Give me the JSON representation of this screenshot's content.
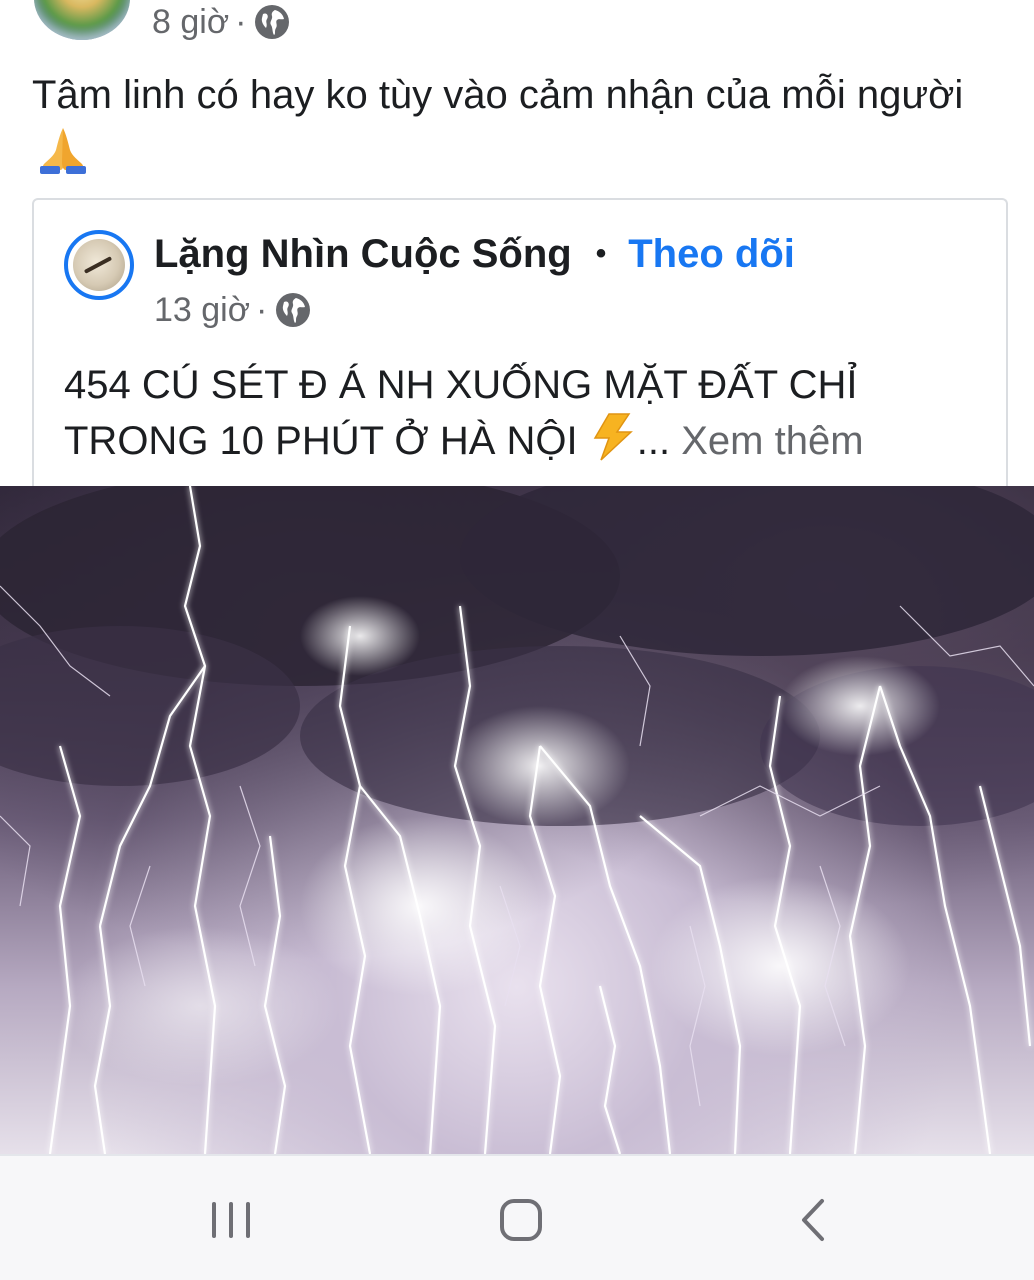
{
  "outer_post": {
    "time": "8 giờ",
    "separator": "·",
    "privacy_icon": "globe-icon",
    "text": "Tâm linh có hay ko tùy vào cảm nhận của mỗi người",
    "emoji": "folded-hands-emoji"
  },
  "shared_post": {
    "author": "Lặng Nhìn Cuộc Sống",
    "dot": "•",
    "follow_label": "Theo dõi",
    "time": "13 giờ",
    "separator": "·",
    "privacy_icon": "globe-icon",
    "text": "454 CÚ SÉT Đ Á NH XUỐNG MẶT ĐẤT CHỈ TRONG 10 PHÚT Ở HÀ NỘI",
    "emoji": "lightning-emoji",
    "ellipsis": "...",
    "see_more_label": "Xem thêm",
    "image": "lightning-storm-photo"
  },
  "system_nav": {
    "recents_icon": "recent-apps-icon",
    "home_icon": "home-icon",
    "back_icon": "back-icon"
  },
  "colors": {
    "link_blue": "#1877f2",
    "secondary_text": "#65676b",
    "primary_text": "#1c1e21",
    "card_border": "#dadde1",
    "nav_bar_bg": "#f7f7f9"
  }
}
